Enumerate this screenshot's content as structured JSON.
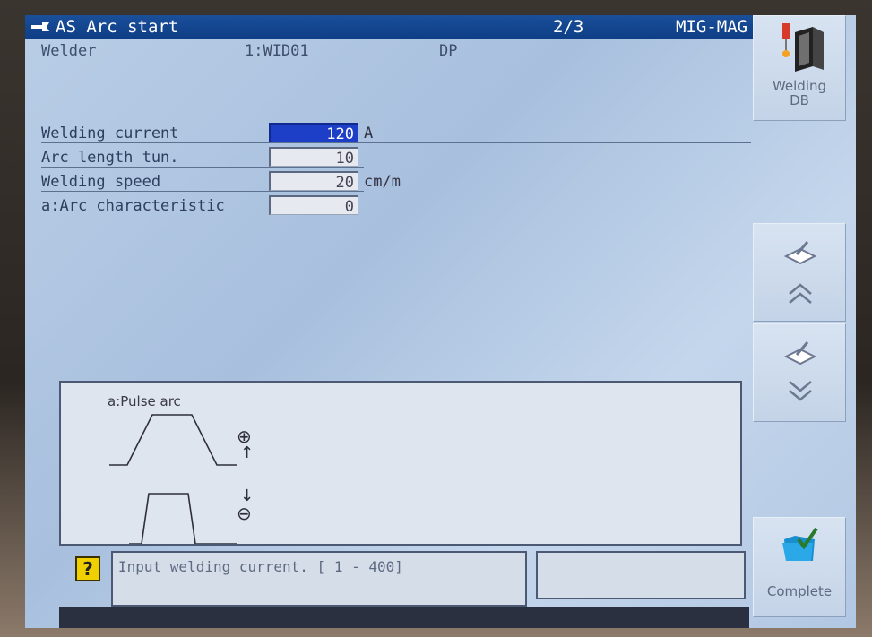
{
  "titlebar": {
    "title": "AS Arc start",
    "page": "2/3",
    "mode": "MIG-MAG"
  },
  "welder": {
    "label": "Welder",
    "value": "1:WID01",
    "type": "DP"
  },
  "params": [
    {
      "label": "Welding current",
      "value": "120",
      "unit": "A",
      "selected": true
    },
    {
      "label": "Arc length tun.",
      "value": "10",
      "unit": ""
    },
    {
      "label": "Welding speed",
      "value": "20",
      "unit": "cm/m"
    },
    {
      "label": "a:Arc characteristic",
      "value": "0",
      "unit": ""
    }
  ],
  "side_buttons": {
    "welding_db": "Welding\nDB",
    "page_up_icon": "book-pen-up-icon",
    "page_down_icon": "book-pen-down-icon",
    "complete": "Complete"
  },
  "info_panel": {
    "title": "a:Pulse arc",
    "plus_symbol": "⊕",
    "minus_symbol": "⊖",
    "up_arrow": "↑",
    "down_arrow": "↓"
  },
  "status": {
    "help_symbol": "?",
    "message": "Input welding current.  [  1 - 400]"
  },
  "colors": {
    "titlebar": "#0e3e86",
    "selected_field": "#1d3fc8",
    "screen_bg": "#b9cde6",
    "help_icon": "#f0d000"
  }
}
